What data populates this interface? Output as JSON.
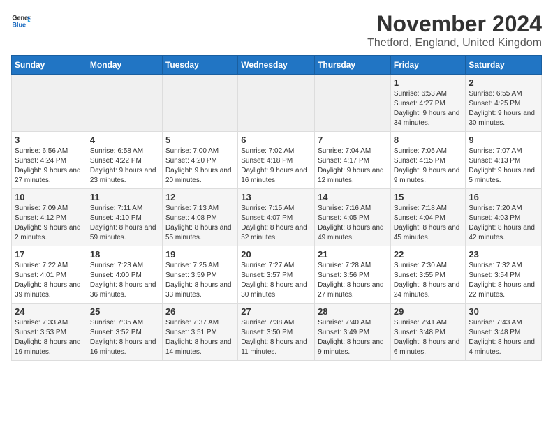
{
  "logo": {
    "text_general": "General",
    "text_blue": "Blue"
  },
  "header": {
    "month": "November 2024",
    "location": "Thetford, England, United Kingdom"
  },
  "weekdays": [
    "Sunday",
    "Monday",
    "Tuesday",
    "Wednesday",
    "Thursday",
    "Friday",
    "Saturday"
  ],
  "weeks": [
    [
      {
        "day": "",
        "empty": true
      },
      {
        "day": "",
        "empty": true
      },
      {
        "day": "",
        "empty": true
      },
      {
        "day": "",
        "empty": true
      },
      {
        "day": "",
        "empty": true
      },
      {
        "day": "1",
        "sunrise": "6:53 AM",
        "sunset": "4:27 PM",
        "daylight": "9 hours and 34 minutes."
      },
      {
        "day": "2",
        "sunrise": "6:55 AM",
        "sunset": "4:25 PM",
        "daylight": "9 hours and 30 minutes."
      }
    ],
    [
      {
        "day": "3",
        "sunrise": "6:56 AM",
        "sunset": "4:24 PM",
        "daylight": "9 hours and 27 minutes."
      },
      {
        "day": "4",
        "sunrise": "6:58 AM",
        "sunset": "4:22 PM",
        "daylight": "9 hours and 23 minutes."
      },
      {
        "day": "5",
        "sunrise": "7:00 AM",
        "sunset": "4:20 PM",
        "daylight": "9 hours and 20 minutes."
      },
      {
        "day": "6",
        "sunrise": "7:02 AM",
        "sunset": "4:18 PM",
        "daylight": "9 hours and 16 minutes."
      },
      {
        "day": "7",
        "sunrise": "7:04 AM",
        "sunset": "4:17 PM",
        "daylight": "9 hours and 12 minutes."
      },
      {
        "day": "8",
        "sunrise": "7:05 AM",
        "sunset": "4:15 PM",
        "daylight": "9 hours and 9 minutes."
      },
      {
        "day": "9",
        "sunrise": "7:07 AM",
        "sunset": "4:13 PM",
        "daylight": "9 hours and 5 minutes."
      }
    ],
    [
      {
        "day": "10",
        "sunrise": "7:09 AM",
        "sunset": "4:12 PM",
        "daylight": "9 hours and 2 minutes."
      },
      {
        "day": "11",
        "sunrise": "7:11 AM",
        "sunset": "4:10 PM",
        "daylight": "8 hours and 59 minutes."
      },
      {
        "day": "12",
        "sunrise": "7:13 AM",
        "sunset": "4:08 PM",
        "daylight": "8 hours and 55 minutes."
      },
      {
        "day": "13",
        "sunrise": "7:15 AM",
        "sunset": "4:07 PM",
        "daylight": "8 hours and 52 minutes."
      },
      {
        "day": "14",
        "sunrise": "7:16 AM",
        "sunset": "4:05 PM",
        "daylight": "8 hours and 49 minutes."
      },
      {
        "day": "15",
        "sunrise": "7:18 AM",
        "sunset": "4:04 PM",
        "daylight": "8 hours and 45 minutes."
      },
      {
        "day": "16",
        "sunrise": "7:20 AM",
        "sunset": "4:03 PM",
        "daylight": "8 hours and 42 minutes."
      }
    ],
    [
      {
        "day": "17",
        "sunrise": "7:22 AM",
        "sunset": "4:01 PM",
        "daylight": "8 hours and 39 minutes."
      },
      {
        "day": "18",
        "sunrise": "7:23 AM",
        "sunset": "4:00 PM",
        "daylight": "8 hours and 36 minutes."
      },
      {
        "day": "19",
        "sunrise": "7:25 AM",
        "sunset": "3:59 PM",
        "daylight": "8 hours and 33 minutes."
      },
      {
        "day": "20",
        "sunrise": "7:27 AM",
        "sunset": "3:57 PM",
        "daylight": "8 hours and 30 minutes."
      },
      {
        "day": "21",
        "sunrise": "7:28 AM",
        "sunset": "3:56 PM",
        "daylight": "8 hours and 27 minutes."
      },
      {
        "day": "22",
        "sunrise": "7:30 AM",
        "sunset": "3:55 PM",
        "daylight": "8 hours and 24 minutes."
      },
      {
        "day": "23",
        "sunrise": "7:32 AM",
        "sunset": "3:54 PM",
        "daylight": "8 hours and 22 minutes."
      }
    ],
    [
      {
        "day": "24",
        "sunrise": "7:33 AM",
        "sunset": "3:53 PM",
        "daylight": "8 hours and 19 minutes."
      },
      {
        "day": "25",
        "sunrise": "7:35 AM",
        "sunset": "3:52 PM",
        "daylight": "8 hours and 16 minutes."
      },
      {
        "day": "26",
        "sunrise": "7:37 AM",
        "sunset": "3:51 PM",
        "daylight": "8 hours and 14 minutes."
      },
      {
        "day": "27",
        "sunrise": "7:38 AM",
        "sunset": "3:50 PM",
        "daylight": "8 hours and 11 minutes."
      },
      {
        "day": "28",
        "sunrise": "7:40 AM",
        "sunset": "3:49 PM",
        "daylight": "8 hours and 9 minutes."
      },
      {
        "day": "29",
        "sunrise": "7:41 AM",
        "sunset": "3:48 PM",
        "daylight": "8 hours and 6 minutes."
      },
      {
        "day": "30",
        "sunrise": "7:43 AM",
        "sunset": "3:48 PM",
        "daylight": "8 hours and 4 minutes."
      }
    ]
  ],
  "labels": {
    "sunrise": "Sunrise:",
    "sunset": "Sunset:",
    "daylight": "Daylight:"
  }
}
